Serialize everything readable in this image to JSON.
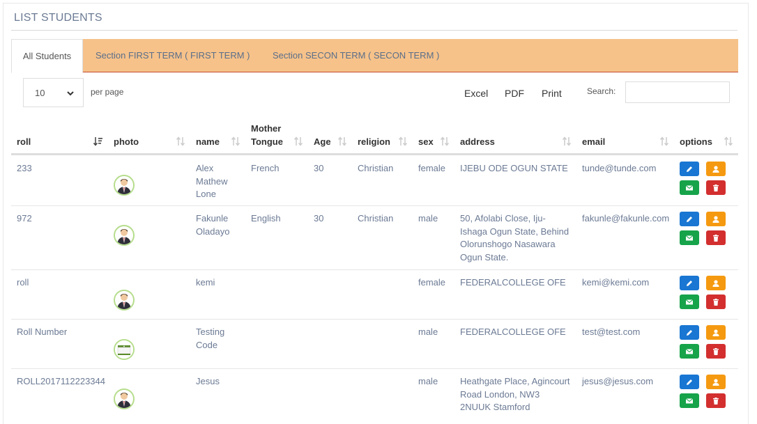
{
  "page": {
    "title": "LIST STUDENTS"
  },
  "tabs": [
    {
      "label": "All Students"
    },
    {
      "label": "Section FIRST TERM ( FIRST TERM )"
    },
    {
      "label": "Section SECON TERM ( SECON TERM )"
    }
  ],
  "controls": {
    "page_length": "10",
    "per_page_label": "per page",
    "export": [
      "Excel",
      "PDF",
      "Print"
    ],
    "search_label": "Search:",
    "search_value": ""
  },
  "columns": [
    "roll",
    "photo",
    "name",
    "Mother Tongue",
    "Age",
    "religion",
    "sex",
    "address",
    "email",
    "options"
  ],
  "rows": [
    {
      "roll": "233",
      "photo": "student-avatar",
      "name": [
        "Alex",
        "Mathew",
        "Lone"
      ],
      "mother_tongue": "French",
      "age": "30",
      "religion": "Christian",
      "sex": "female",
      "address": [
        "IJEBU ODE OGUN STATE"
      ],
      "email": "tunde@tunde.com"
    },
    {
      "roll": "972",
      "photo": "student-avatar",
      "name": [
        "Fakunle",
        "Oladayo"
      ],
      "mother_tongue": "English",
      "age": "30",
      "religion": "Christian",
      "sex": "male",
      "address": [
        "50, Afolabi Close, Iju-",
        "Ishaga Ogun State, Behind",
        "Olorunshogo Nasawara",
        "Ogun State."
      ],
      "email": "fakunle@fakunle.com"
    },
    {
      "roll": "roll",
      "photo": "student-avatar",
      "name": [
        "kemi"
      ],
      "mother_tongue": "",
      "age": "",
      "religion": "",
      "sex": "female",
      "address": [
        "FEDERALCOLLEGE OFE"
      ],
      "email": "kemi@kemi.com"
    },
    {
      "roll": "Roll Number",
      "photo": "custom-photo",
      "name": [
        "Testing",
        "Code"
      ],
      "mother_tongue": "",
      "age": "",
      "religion": "",
      "sex": "male",
      "address": [
        "FEDERALCOLLEGE OFE"
      ],
      "email": "test@test.com"
    },
    {
      "roll": "ROLL2017112223344",
      "photo": "student-avatar",
      "name": [
        "Jesus"
      ],
      "mother_tongue": "",
      "age": "",
      "religion": "",
      "sex": "male",
      "address": [
        "Heathgate Place, Agincourt",
        "Road London, NW3",
        "2NUUK Stamford"
      ],
      "email": "jesus@jesus.com"
    }
  ],
  "option_icons": [
    "pencil-icon",
    "user-icon",
    "envelope-icon",
    "trash-icon"
  ],
  "colors": {
    "tab_bar": "#f6c28a",
    "tab_bar_border": "#c24a2e",
    "edit": "#1976d2",
    "profile": "#f59a10",
    "mail": "#16a34a",
    "delete": "#d32f2f",
    "avatar_ring": "#b6dd8c"
  }
}
